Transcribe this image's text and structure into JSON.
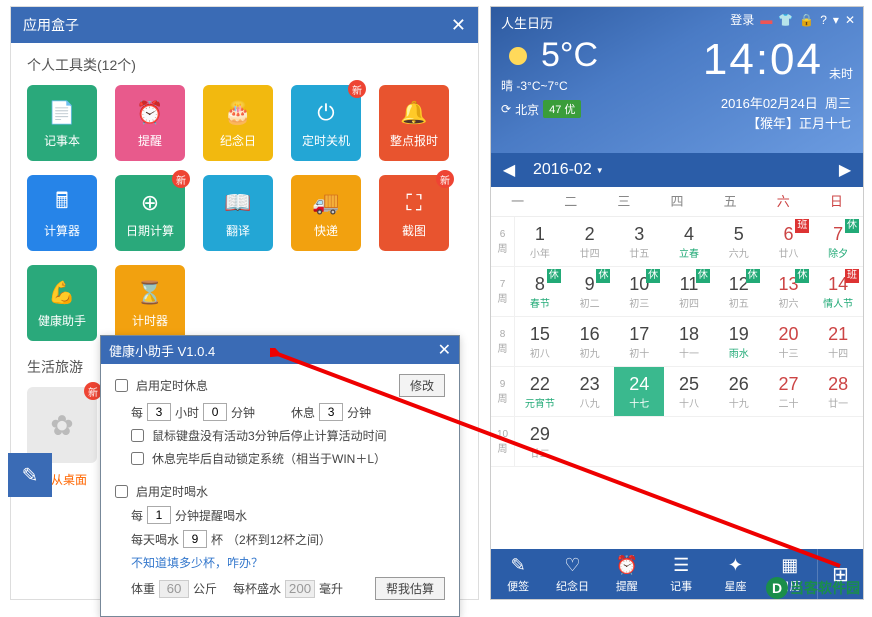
{
  "left": {
    "title": "应用盒子",
    "cat1": "个人工具类(12个)",
    "cat2": "生活旅游",
    "hint": "可以从桌面",
    "new_badge": "新",
    "tools": [
      {
        "label": "记事本",
        "bg": "#2aa97b"
      },
      {
        "label": "提醒",
        "bg": "#e85a8c"
      },
      {
        "label": "纪念日",
        "bg": "#f2b90f"
      },
      {
        "label": "定时关机",
        "bg": "#23a6d5",
        "new": true
      },
      {
        "label": "整点报时",
        "bg": "#e8542f"
      },
      {
        "label": "计算器",
        "bg": "#2684e8"
      },
      {
        "label": "日期计算",
        "bg": "#2aa97b",
        "new": true
      },
      {
        "label": "翻译",
        "bg": "#23a6d5"
      },
      {
        "label": "快递",
        "bg": "#f2a10f"
      },
      {
        "label": "截图",
        "bg": "#e8542f",
        "new": true
      },
      {
        "label": "健康助手",
        "bg": "#2aa97b"
      },
      {
        "label": "计时器",
        "bg": "#f2a10f"
      }
    ]
  },
  "dialog": {
    "title": "健康小助手  V1.0.4",
    "enable_rest": "启用定时休息",
    "every": "每",
    "hour": "小时",
    "minute": "分钟",
    "rest": "休息",
    "v_hour": "3",
    "v_min": "0",
    "v_rest": "3",
    "modify": "修改",
    "line1": "鼠标键盘没有活动3分钟后停止计算活动时间",
    "line2": "休息完毕后自动锁定系统（相当于WIN＋L）",
    "enable_drink": "启用定时喝水",
    "v_drinkmin": "1",
    "drink_remind": "分钟提醒喝水",
    "daily": "每天喝水",
    "v_cups": "9",
    "cup": "杯",
    "cup_note": "（2杯到12杯之间）",
    "link": "不知道填多少杯，咋办？",
    "weight_l": "体重",
    "v_weight": "60",
    "kg": "公斤",
    "percup": "每杯盛水",
    "v_ml": "200",
    "ml": "毫升",
    "calc_btn": "帮我估算"
  },
  "cal": {
    "title": "人生日历",
    "login": "登录",
    "temp": "5°C",
    "cond": "晴",
    "range": "-3°C~7°C",
    "refresh": "⟳",
    "city": "北京",
    "aqi": "47 优",
    "time": "14:04",
    "time_label": "未时",
    "date": "2016年02月24日",
    "weekday": "周三",
    "lunar": "【猴年】正月十七",
    "ym": "2016-02",
    "weekdays": [
      "一",
      "二",
      "三",
      "四",
      "五",
      "六",
      "日"
    ],
    "ban": "班",
    "xiu": "休",
    "weeks": [
      {
        "idx": "6",
        "wk": "周",
        "days": [
          {
            "n": "1",
            "s": "小年",
            "sat": false
          },
          {
            "n": "2",
            "s": "廿四"
          },
          {
            "n": "3",
            "s": "廿五"
          },
          {
            "n": "4",
            "s": "立春",
            "term": true
          },
          {
            "n": "5",
            "s": "六九"
          },
          {
            "n": "6",
            "s": "廿八",
            "tag": "ban",
            "sat": true
          },
          {
            "n": "7",
            "s": "除夕",
            "term": true,
            "tag": "xiu",
            "sun": true
          }
        ]
      },
      {
        "idx": "7",
        "wk": "周",
        "days": [
          {
            "n": "8",
            "s": "春节",
            "term": true,
            "tag": "xiu"
          },
          {
            "n": "9",
            "s": "初二",
            "tag": "xiu"
          },
          {
            "n": "10",
            "s": "初三",
            "tag": "xiu"
          },
          {
            "n": "11",
            "s": "初四",
            "tag": "xiu"
          },
          {
            "n": "12",
            "s": "初五",
            "tag": "xiu"
          },
          {
            "n": "13",
            "s": "初六",
            "tag": "xiu",
            "sat": true
          },
          {
            "n": "14",
            "s": "情人节",
            "term": true,
            "tag": "ban",
            "sun": true
          }
        ]
      },
      {
        "idx": "8",
        "wk": "周",
        "days": [
          {
            "n": "15",
            "s": "初八"
          },
          {
            "n": "16",
            "s": "初九"
          },
          {
            "n": "17",
            "s": "初十"
          },
          {
            "n": "18",
            "s": "十一"
          },
          {
            "n": "19",
            "s": "雨水",
            "term": true
          },
          {
            "n": "20",
            "s": "十三",
            "sat": true
          },
          {
            "n": "21",
            "s": "十四",
            "sun": true
          }
        ]
      },
      {
        "idx": "9",
        "wk": "周",
        "days": [
          {
            "n": "22",
            "s": "元宵节",
            "term": true
          },
          {
            "n": "23",
            "s": "八九"
          },
          {
            "n": "24",
            "s": "十七",
            "today": true
          },
          {
            "n": "25",
            "s": "十八"
          },
          {
            "n": "26",
            "s": "十九"
          },
          {
            "n": "27",
            "s": "二十",
            "sat": true
          },
          {
            "n": "28",
            "s": "廿一",
            "sun": true
          }
        ]
      },
      {
        "idx": "10",
        "wk": "周",
        "days": [
          {
            "n": "29",
            "s": "廿二"
          },
          {
            "n": "",
            "s": ""
          },
          {
            "n": "",
            "s": ""
          },
          {
            "n": "",
            "s": ""
          },
          {
            "n": "",
            "s": ""
          },
          {
            "n": "",
            "s": "",
            "sat": true
          },
          {
            "n": "",
            "s": "",
            "sun": true
          }
        ]
      }
    ],
    "bottom": [
      {
        "l": "便签",
        "i": "✎"
      },
      {
        "l": "纪念日",
        "i": "♡"
      },
      {
        "l": "提醒",
        "i": "⏰"
      },
      {
        "l": "记事",
        "i": "☰"
      },
      {
        "l": "星座",
        "i": "✦"
      },
      {
        "l": "日历",
        "i": "▦"
      }
    ]
  },
  "watermark": "当客软件园"
}
